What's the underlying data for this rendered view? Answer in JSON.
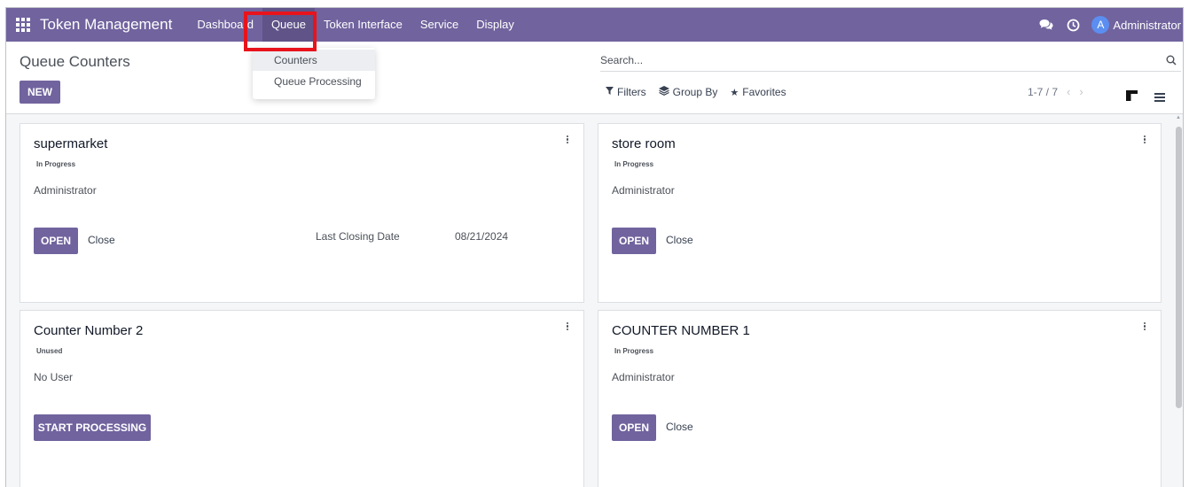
{
  "navbar": {
    "brand": "Token Management",
    "menu": [
      "Dashboard",
      "Queue",
      "Token Interface",
      "Service",
      "Display"
    ],
    "active_index": 1,
    "avatar_letter": "A",
    "user_name": "Administrator",
    "colors": {
      "navbar_bg": "#71639e",
      "active_bg": "#5f5388",
      "avatar_bg": "#5b8ef0"
    }
  },
  "dropdown": {
    "items": [
      "Counters",
      "Queue Processing"
    ],
    "hovered_index": 0
  },
  "control_panel": {
    "title": "Queue Counters",
    "new_label": "NEW",
    "search_placeholder": "Search...",
    "filters_label": "Filters",
    "group_by_label": "Group By",
    "favorites_label": "Favorites",
    "pager": "1-7 / 7"
  },
  "cards": [
    {
      "title": "supermarket",
      "badge": "In Progress",
      "user": "Administrator",
      "button": "OPEN",
      "secondary": "Close",
      "last_closing_label": "Last Closing Date",
      "last_closing_value": "08/21/2024"
    },
    {
      "title": "store room",
      "badge": "In Progress",
      "user": "Administrator",
      "button": "OPEN",
      "secondary": "Close"
    },
    {
      "title": "Counter Number 2",
      "badge": "Unused",
      "user": "No User",
      "button": "START PROCESSING"
    },
    {
      "title": "COUNTER NUMBER 1",
      "badge": "In Progress",
      "user": "Administrator",
      "button": "OPEN",
      "secondary": "Close"
    }
  ],
  "accent_color": "#71639e",
  "highlight_color": "#e8131b"
}
